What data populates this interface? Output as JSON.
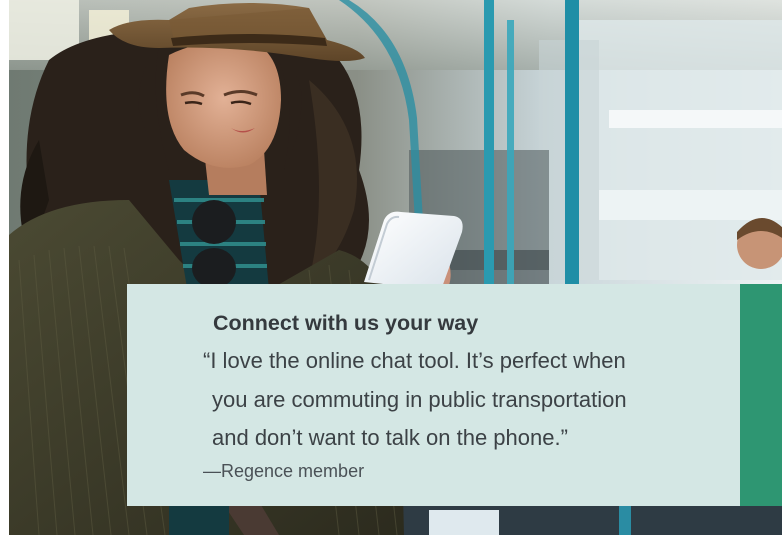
{
  "card": {
    "heading": "Connect with us your way",
    "quote_lines": [
      "“I love the online chat tool. It’s perfect when",
      "you are commuting in public transportation",
      "and don’t want to talk on the phone.”"
    ],
    "attribution": "—Regence member"
  },
  "colors": {
    "card_background": "#d4e7e4",
    "accent_green": "#2e9672",
    "text_dark": "#353a3e"
  }
}
